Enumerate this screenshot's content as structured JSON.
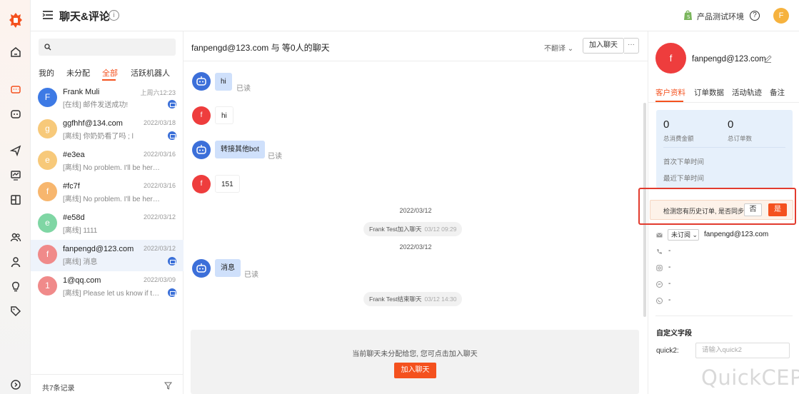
{
  "app": {
    "title": "聊天&评论",
    "env_label": "产品测试环境",
    "user_initial": "F",
    "accent": "#f4511e"
  },
  "conversation_list": {
    "search_placeholder": "",
    "tabs": [
      "我的",
      "未分配",
      "全部",
      "活跃机器人"
    ],
    "active_tab": "全部",
    "items": [
      {
        "initial": "F",
        "color": "#3d7ae5",
        "name": "Frank Muli",
        "date": "上周六12:23",
        "message": "[在线] 邮件发送成功!",
        "mail": true
      },
      {
        "initial": "g",
        "color": "#f7c97a",
        "name": "ggfhhf@134.com",
        "date": "2022/03/18",
        "message": "[离线] 你奶奶看了吗 ; l",
        "mail": true
      },
      {
        "initial": "e",
        "color": "#f7c97a",
        "name": "#e3ea",
        "date": "2022/03/16",
        "message": "[离线] No problem. I'll be here in case you need any help",
        "mail": false
      },
      {
        "initial": "f",
        "color": "#f7b66e",
        "name": "#fc7f",
        "date": "2022/03/16",
        "message": "[离线] No problem. I'll be here in case you need any help",
        "mail": false
      },
      {
        "initial": "e",
        "color": "#7fd6a4",
        "name": "#e58d",
        "date": "2022/03/12",
        "message": "[离线] 1111",
        "mail": false
      },
      {
        "initial": "f",
        "color": "#f08a8a",
        "name": "fanpengd@123.com",
        "date": "2022/03/12",
        "message": "[离线] 消息",
        "mail": true
      },
      {
        "initial": "1",
        "color": "#f08a8a",
        "name": "1@qq.com",
        "date": "2022/03/09",
        "message": "[离线] Please let us know if there is anything else",
        "mail": true
      }
    ],
    "footer_count": "共7条记录"
  },
  "chat": {
    "title": "fanpengd@123.com 与 等0人的聊天",
    "translate_label": "不翻译",
    "join_label": "加入聊天",
    "more_label": "···",
    "messages": [
      {
        "from": "bot",
        "text": "hi",
        "read": "已读"
      },
      {
        "from": "user",
        "initial": "f",
        "text": "hi"
      },
      {
        "from": "bot",
        "text": "转接其他bot",
        "read": "已读"
      },
      {
        "from": "user",
        "initial": "f",
        "text": "151"
      }
    ],
    "date1": "2022/03/12",
    "sys1": {
      "text": "Frank Test加入聊天",
      "time": "03/12 09:29"
    },
    "date2": "2022/03/12",
    "msg_bot2": {
      "text": "消息",
      "read": "已读"
    },
    "sys2": {
      "text": "Frank Test结束聊天",
      "time": "03/12 14:30"
    },
    "unassigned_text": "当前聊天未分配给您, 您可点击加入聊天",
    "unassigned_button": "加入聊天"
  },
  "customer": {
    "initial": "f",
    "email": "fanpengd@123.com",
    "tabs": [
      "客户资料",
      "订单数据",
      "活动轨迹",
      "备注"
    ],
    "active_tab": "客户资料",
    "total_spend": "0",
    "total_spend_label": "总消费金额",
    "total_orders": "0",
    "total_orders_label": "总订单数",
    "first_order_label": "首次下单时间",
    "last_order_label": "最近下单时间",
    "sync_notice": "检测您有历史订单, 是否同步",
    "sync_no": "否",
    "sync_yes": "是",
    "subscription": "未订阅",
    "sub_email": "fanpengd@123.com",
    "phone": "-",
    "instagram": "-",
    "messenger": "-",
    "whatsapp": "-",
    "custom_fields_title": "自定义字段",
    "quick2_label": "quick2:",
    "quick2_placeholder": "请输入quick2"
  },
  "watermark": "QuickCEP"
}
